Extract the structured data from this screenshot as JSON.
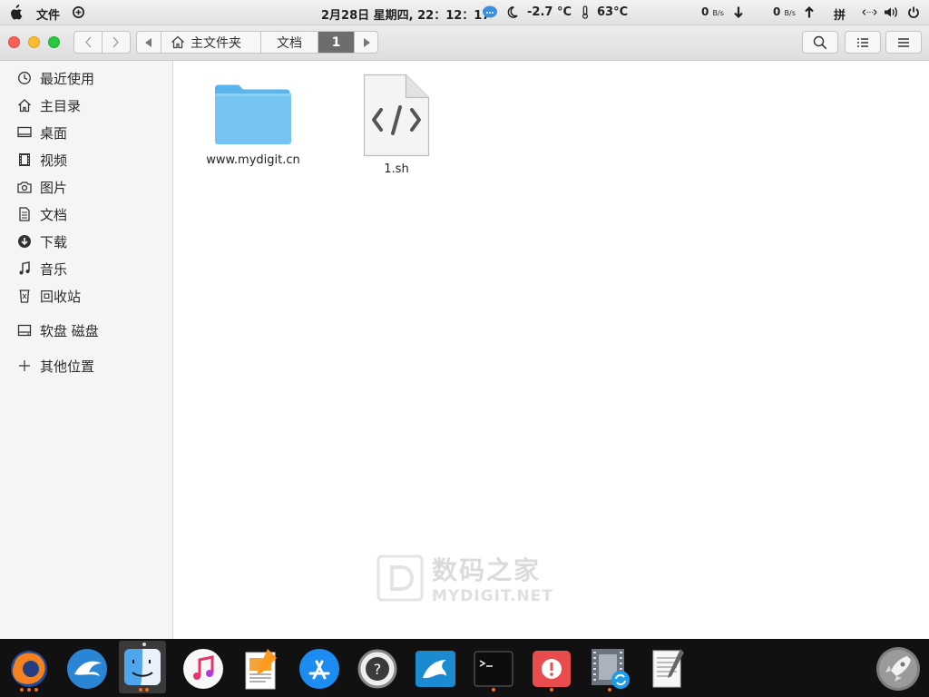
{
  "topbar": {
    "app_menu": "文件",
    "clock": "2月28日 星期四, 22：12：17",
    "temperature": "-2.7 °C",
    "cpu_temp": "63°C",
    "net_down_value": "0",
    "net_down_unit": "B/s",
    "net_up_value": "0",
    "net_up_unit": "B/s",
    "input_method": "拼"
  },
  "window": {
    "path": [
      "主文件夹",
      "文档",
      "1"
    ]
  },
  "sidebar": {
    "items": [
      {
        "label": "最近使用",
        "icon": "clock-icon"
      },
      {
        "label": "主目录",
        "icon": "home-icon"
      },
      {
        "label": "桌面",
        "icon": "desktop-icon"
      },
      {
        "label": "视频",
        "icon": "video-icon"
      },
      {
        "label": "图片",
        "icon": "camera-icon"
      },
      {
        "label": "文档",
        "icon": "document-icon"
      },
      {
        "label": "下载",
        "icon": "download-icon"
      },
      {
        "label": "音乐",
        "icon": "music-icon"
      },
      {
        "label": "回收站",
        "icon": "trash-icon"
      },
      {
        "label": "软盘 磁盘",
        "icon": "drive-icon"
      },
      {
        "label": "其他位置",
        "icon": "plus-icon"
      }
    ]
  },
  "files": [
    {
      "name": "www.mydigit.cn",
      "type": "folder"
    },
    {
      "name": "1.sh",
      "type": "script"
    }
  ],
  "watermark": {
    "title": "数码之家",
    "subtitle": "MYDIGIT.NET"
  },
  "dock": {
    "items": [
      "firefox-icon",
      "eagle-icon",
      "finder-icon",
      "music-app-icon",
      "pages-icon",
      "app-store-icon",
      "help-icon",
      "mysql-workbench-icon",
      "terminal-icon",
      "alert-app-icon",
      "video-converter-icon",
      "text-editor-icon",
      "launchpad-icon"
    ]
  }
}
